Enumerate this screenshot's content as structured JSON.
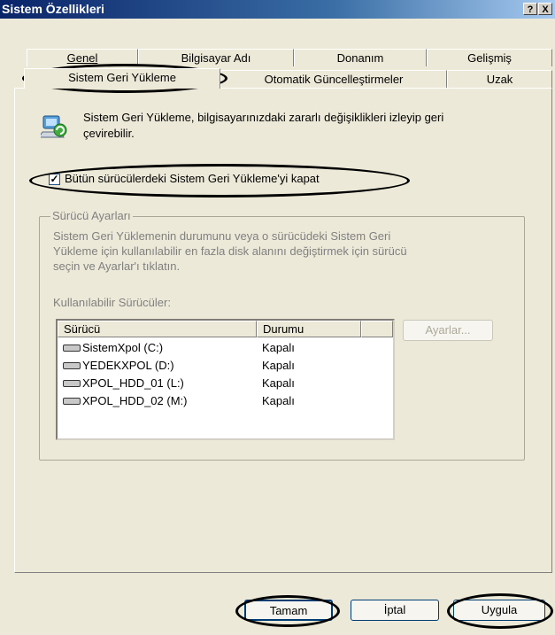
{
  "window": {
    "title": "Sistem Özellikleri",
    "help_btn": "?",
    "close_btn": "X"
  },
  "tabs_row1": [
    {
      "label": "Genel"
    },
    {
      "label": "Bilgisayar Adı"
    },
    {
      "label": "Donanım"
    },
    {
      "label": "Gelişmiş"
    }
  ],
  "tabs_row2": [
    {
      "label": "Sistem Geri Yükleme"
    },
    {
      "label": "Otomatik Güncelleştirmeler"
    },
    {
      "label": "Uzak"
    }
  ],
  "info": {
    "line1": "Sistem Geri Yükleme, bilgisayarınızdaki zararlı değişiklikleri izleyip geri",
    "line2": "çevirebilir."
  },
  "checkbox": {
    "label": "Bütün sürücülerdeki Sistem Geri Yükleme'yi kapat",
    "checked": true
  },
  "group": {
    "title": "Sürücü Ayarları",
    "desc1": "Sistem Geri Yüklemenin durumunu veya o sürücüdeki Sistem Geri",
    "desc2": "Yükleme için kullanılabilir en fazla disk alanını değiştirmek için sürücü",
    "desc3": "seçin ve Ayarlar'ı tıklatın.",
    "available_label": "Kullanılabilir Sürücüler:"
  },
  "drive_table": {
    "columns": [
      "Sürücü",
      "Durumu"
    ],
    "rows": [
      {
        "drive": "SistemXpol (C:)",
        "status": "Kapalı"
      },
      {
        "drive": "YEDEKXPOL (D:)",
        "status": "Kapalı"
      },
      {
        "drive": "XPOL_HDD_01 (L:)",
        "status": "Kapalı"
      },
      {
        "drive": "XPOL_HDD_02 (M:)",
        "status": "Kapalı"
      }
    ]
  },
  "buttons": {
    "settings": "Ayarlar...",
    "ok": "Tamam",
    "cancel": "İptal",
    "apply": "Uygula"
  }
}
